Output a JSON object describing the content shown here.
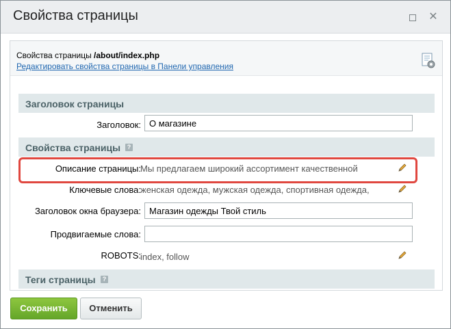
{
  "dialog": {
    "title": "Свойства страницы"
  },
  "info": {
    "path_prefix": "Свойства страницы ",
    "path": "/about/index.php",
    "edit_link": "Редактировать свойства страницы в Панели управления"
  },
  "sections": {
    "heading": "Заголовок страницы",
    "properties": "Свойства страницы",
    "tags": "Теги страницы",
    "help_glyph": "?"
  },
  "fields": {
    "title_label": "Заголовок:",
    "title_value": "О магазине",
    "description_label": "Описание страницы:",
    "description_value": "Мы предлагаем широкий ассортимент качественной",
    "keywords_label": "Ключевые слова:",
    "keywords_value": "женская одежда, мужская одежда, спортивная одежда,",
    "browser_title_label": "Заголовок окна браузера:",
    "browser_title_value": "Магазин одежды Твой стиль",
    "promoted_label": "Продвигаемые слова:",
    "promoted_value": "",
    "robots_label": "ROBOTS:",
    "robots_value": "index, follow"
  },
  "buttons": {
    "save": "Сохранить",
    "cancel": "Отменить"
  },
  "colors": {
    "highlight": "#e0473f",
    "save_button": "#76b733",
    "link": "#2067b0",
    "section_bg": "#e0e8ea"
  }
}
